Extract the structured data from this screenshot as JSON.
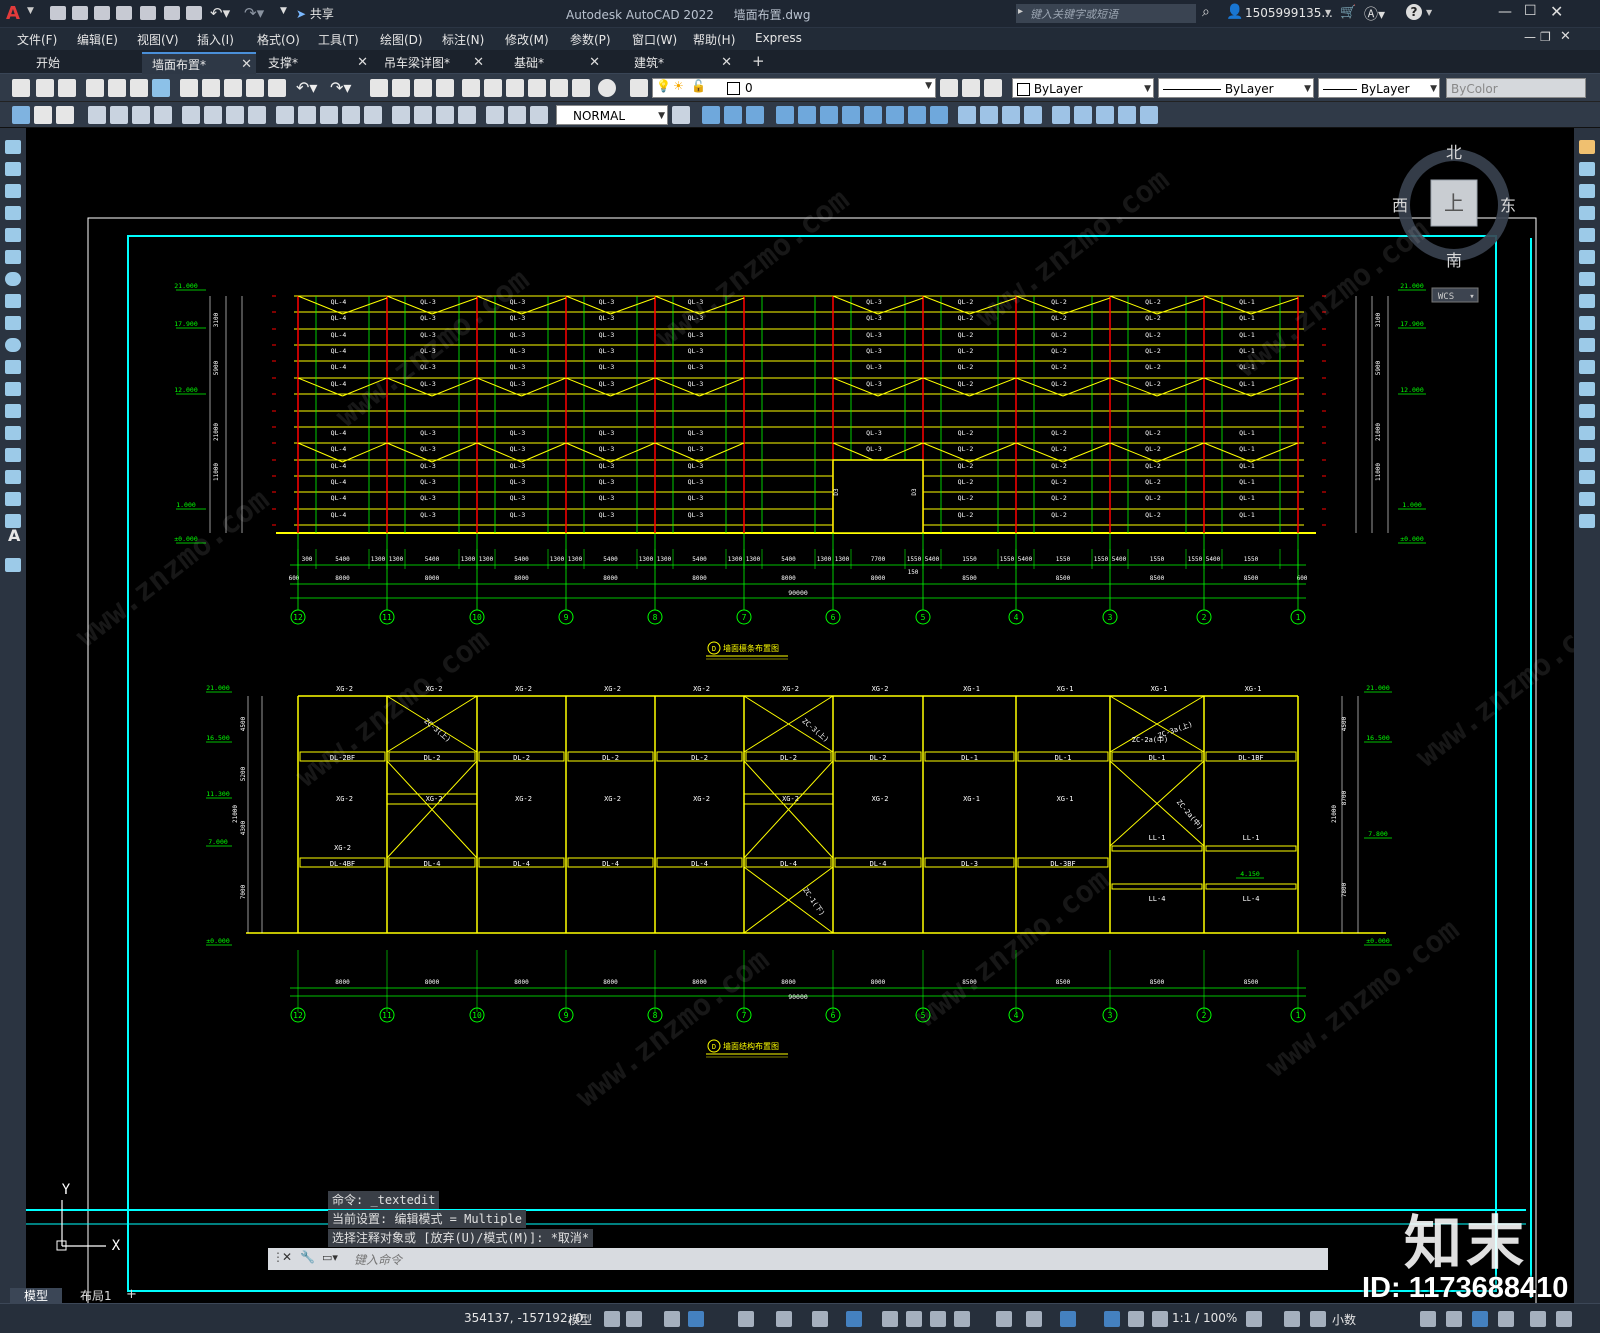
{
  "title_bar": {
    "app_title": "Autodesk AutoCAD 2022",
    "file_name": "墙面布置.dwg",
    "share_label": "共享",
    "search_placeholder": "键入关键字或短语",
    "user": "1505999135...",
    "logo_letter": "A"
  },
  "menu": [
    "文件(F)",
    "编辑(E)",
    "视图(V)",
    "插入(I)",
    "格式(O)",
    "工具(T)",
    "绘图(D)",
    "标注(N)",
    "修改(M)",
    "参数(P)",
    "窗口(W)",
    "帮助(H)",
    "Express"
  ],
  "tabs": [
    {
      "label": "开始",
      "closable": false,
      "active": false
    },
    {
      "label": "墙面布置*",
      "closable": true,
      "active": true
    },
    {
      "label": "支撑*",
      "closable": true,
      "active": false
    },
    {
      "label": "吊车梁详图*",
      "closable": true,
      "active": false
    },
    {
      "label": "基础*",
      "closable": true,
      "active": false
    },
    {
      "label": "建筑*",
      "closable": true,
      "active": false
    }
  ],
  "new_tab_label": "+",
  "properties_bar": {
    "layer_value": "0",
    "color": "ByLayer",
    "linetype": "ByLayer",
    "lineweight": "ByLayer",
    "plotstyle": "ByColor",
    "text_style": "NORMAL"
  },
  "viewcube": {
    "north": "北",
    "south": "南",
    "east": "东",
    "west": "西",
    "top": "上",
    "wcs": "WCS"
  },
  "drawing": {
    "top_title": "墙面檩条布置图",
    "bottom_title": "墙面结构布置图",
    "title_marker": "D",
    "axis_labels": [
      "12",
      "11",
      "10",
      "9",
      "8",
      "7",
      "6",
      "5",
      "4",
      "3",
      "2",
      "1"
    ],
    "top_elevations_left": [
      "21.000",
      "17.900",
      "12.000",
      "1.000",
      "±0.000"
    ],
    "top_elevations_right": [
      "21.000",
      "17.900",
      "12.000",
      "1.000",
      "±0.000"
    ],
    "top_dims_row1": [
      "300",
      "5400",
      "1300",
      "1300",
      "5400",
      "1300",
      "1300",
      "5400",
      "1300",
      "1300",
      "5400",
      "1300",
      "1300",
      "5400",
      "1300",
      "1300",
      "5400",
      "1300",
      "1300",
      "7700",
      "1550",
      "5400",
      "1550",
      "1550",
      "5400",
      "1550",
      "1550",
      "5400",
      "1550",
      "1550",
      "5400",
      "1550"
    ],
    "top_dims_row2": [
      "600",
      "8000",
      "8000",
      "8000",
      "8000",
      "8000",
      "8000",
      "8000",
      "8500",
      "8500",
      "8500",
      "8500",
      "600"
    ],
    "top_dims_total": "90000",
    "top_dim_mid": "150",
    "purlin_codes": [
      "QL-4",
      "QL-3",
      "QL-3",
      "QL-3",
      "QL-3",
      "QL-3",
      "QL-3",
      "QL-2",
      "QL-2",
      "QL-2",
      "QL-1"
    ],
    "bottom_top_beams": [
      "XG-2",
      "XG-2",
      "XG-2",
      "XG-2",
      "XG-2",
      "XG-2",
      "XG-2",
      "XG-1",
      "XG-1",
      "XG-1",
      "XG-1"
    ],
    "bottom_row2": [
      "DL-2BF",
      "DL-2",
      "DL-2",
      "DL-2",
      "DL-2",
      "DL-2",
      "DL-2",
      "DL-1",
      "DL-1",
      "DL-1",
      "DL-1BF"
    ],
    "bottom_row3": [
      "XG-2",
      "XG-2",
      "XG-2",
      "XG-2",
      "XG-2",
      "XG-2",
      "XG-2",
      "XG-1",
      "XG-1"
    ],
    "bottom_row4": [
      "DL-4BF",
      "DL-4",
      "DL-4",
      "DL-4",
      "DL-4",
      "DL-4",
      "DL-4",
      "DL-3",
      "DL-3BF"
    ],
    "bottom_extra_xg": "XG-2",
    "bottom_bracing": [
      "ZC-3(上)",
      "ZC-3(上)",
      "ZC-3a(上)",
      "ZC-2a(中)",
      "ZC-2a(中)",
      "ZC-1(下)"
    ],
    "bottom_ll": [
      "LL-1",
      "LL-1",
      "LL-4",
      "LL-4"
    ],
    "bottom_dims": [
      "8000",
      "8000",
      "8000",
      "8000",
      "8000",
      "8000",
      "8000",
      "8500",
      "8500",
      "8500",
      "8500"
    ],
    "bottom_total": "90000",
    "bottom_elev_left": [
      "21.000",
      "16.500",
      "11.300",
      "7.000",
      "±0.000"
    ],
    "bottom_elev_right": [
      "21.000",
      "16.500",
      "7.800",
      "4.150",
      "±0.000"
    ],
    "bottom_vdims_left": [
      "4500",
      "5200",
      "4300",
      "7000",
      "21000"
    ],
    "bottom_vdims_right": [
      "4500",
      "8700",
      "7800",
      "21000"
    ],
    "top_vdims_left": [
      "3100",
      "5900",
      "21000",
      "11000"
    ],
    "top_vdims_right": [
      "3100",
      "5900",
      "21000",
      "11000"
    ]
  },
  "ucs": {
    "y": "Y",
    "x": "X"
  },
  "command": {
    "lines": [
      "命令: _textedit",
      "当前设置: 编辑模式 = Multiple",
      "选择注释对象或 [放弃(U)/模式(M)]: *取消*"
    ],
    "placeholder": "键入命令"
  },
  "layout_tabs": [
    "模型",
    "布局1"
  ],
  "status": {
    "coords": "354137, -157192, 0",
    "mode": "模型",
    "scale": "1:1 / 100%",
    "units": "小数"
  },
  "watermark": {
    "brand": "知末",
    "id": "ID: 1173688410",
    "site": "www.znzmo.com"
  },
  "colors": {
    "cad_bg": "#000000",
    "yellow": "#ffff00",
    "green": "#00ff00",
    "red": "#ff0000",
    "cyan": "#00ffff",
    "white": "#ffffff",
    "accent": "#4a8fd8"
  }
}
